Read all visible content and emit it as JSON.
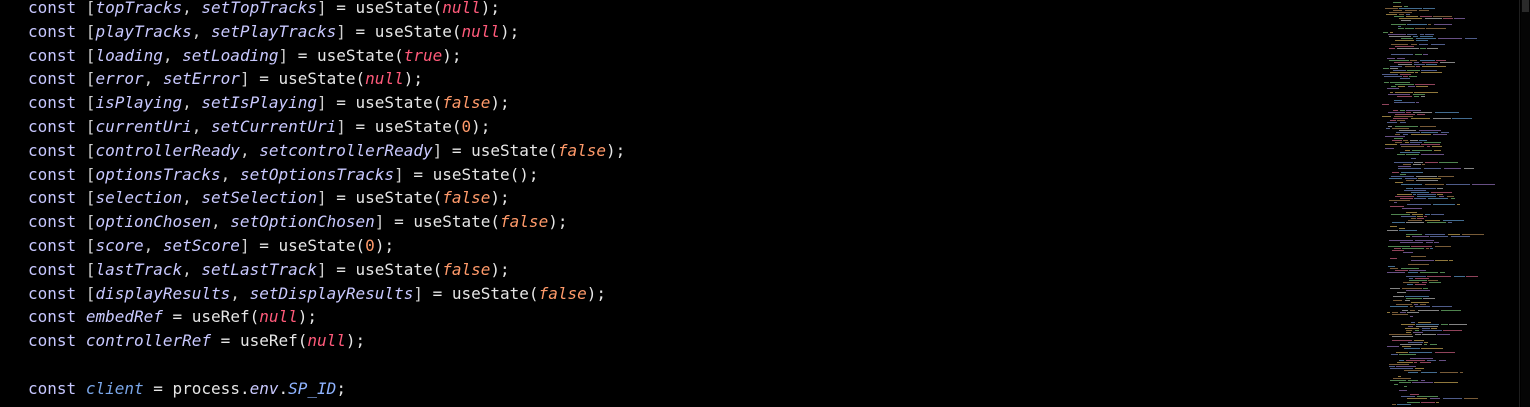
{
  "editor": {
    "lines": [
      {
        "kw": "const",
        "a": "topTracks",
        "b": "setTopTracks",
        "fn": "useState",
        "arg": "null",
        "argType": "null"
      },
      {
        "kw": "const",
        "a": "playTracks",
        "b": "setPlayTracks",
        "fn": "useState",
        "arg": "null",
        "argType": "null"
      },
      {
        "kw": "const",
        "a": "loading",
        "b": "setLoading",
        "fn": "useState",
        "arg": "true",
        "argType": "true"
      },
      {
        "kw": "const",
        "a": "error",
        "b": "setError",
        "fn": "useState",
        "arg": "null",
        "argType": "null"
      },
      {
        "kw": "const",
        "a": "isPlaying",
        "b": "setIsPlaying",
        "fn": "useState",
        "arg": "false",
        "argType": "false"
      },
      {
        "kw": "const",
        "a": "currentUri",
        "b": "setCurrentUri",
        "fn": "useState",
        "arg": "0",
        "argType": "num"
      },
      {
        "kw": "const",
        "a": "controllerReady",
        "b": "setcontrollerReady",
        "fn": "useState",
        "arg": "false",
        "argType": "false"
      },
      {
        "kw": "const",
        "a": "optionsTracks",
        "b": "setOptionsTracks",
        "fn": "useState",
        "arg": "",
        "argType": "none"
      },
      {
        "kw": "const",
        "a": "selection",
        "b": "setSelection",
        "fn": "useState",
        "arg": "false",
        "argType": "false"
      },
      {
        "kw": "const",
        "a": "optionChosen",
        "b": "setOptionChosen",
        "fn": "useState",
        "arg": "false",
        "argType": "false"
      },
      {
        "kw": "const",
        "a": "score",
        "b": "setScore",
        "fn": "useState",
        "arg": "0",
        "argType": "num"
      },
      {
        "kw": "const",
        "a": "lastTrack",
        "b": "setLastTrack",
        "fn": "useState",
        "arg": "false",
        "argType": "false"
      },
      {
        "kw": "const",
        "a": "displayResults",
        "b": "setDisplayResults",
        "fn": "useState",
        "arg": "false",
        "argType": "false"
      }
    ],
    "refs": [
      {
        "kw": "const",
        "name": "embedRef",
        "fn": "useRef",
        "arg": "null"
      },
      {
        "kw": "const",
        "name": "controllerRef",
        "fn": "useRef",
        "arg": "null"
      }
    ],
    "client_line": {
      "kw": "const",
      "name": "client",
      "obj": "process",
      "prop1": "env",
      "prop2": "SP_ID"
    }
  },
  "colors": {
    "background": "#000000",
    "keyword": "#c7c7ff",
    "null_true": "#ff5a7a",
    "false_num": "#ff9a6a",
    "identifier": "#c9c9ff",
    "env_prop": "#8fb3ff"
  }
}
